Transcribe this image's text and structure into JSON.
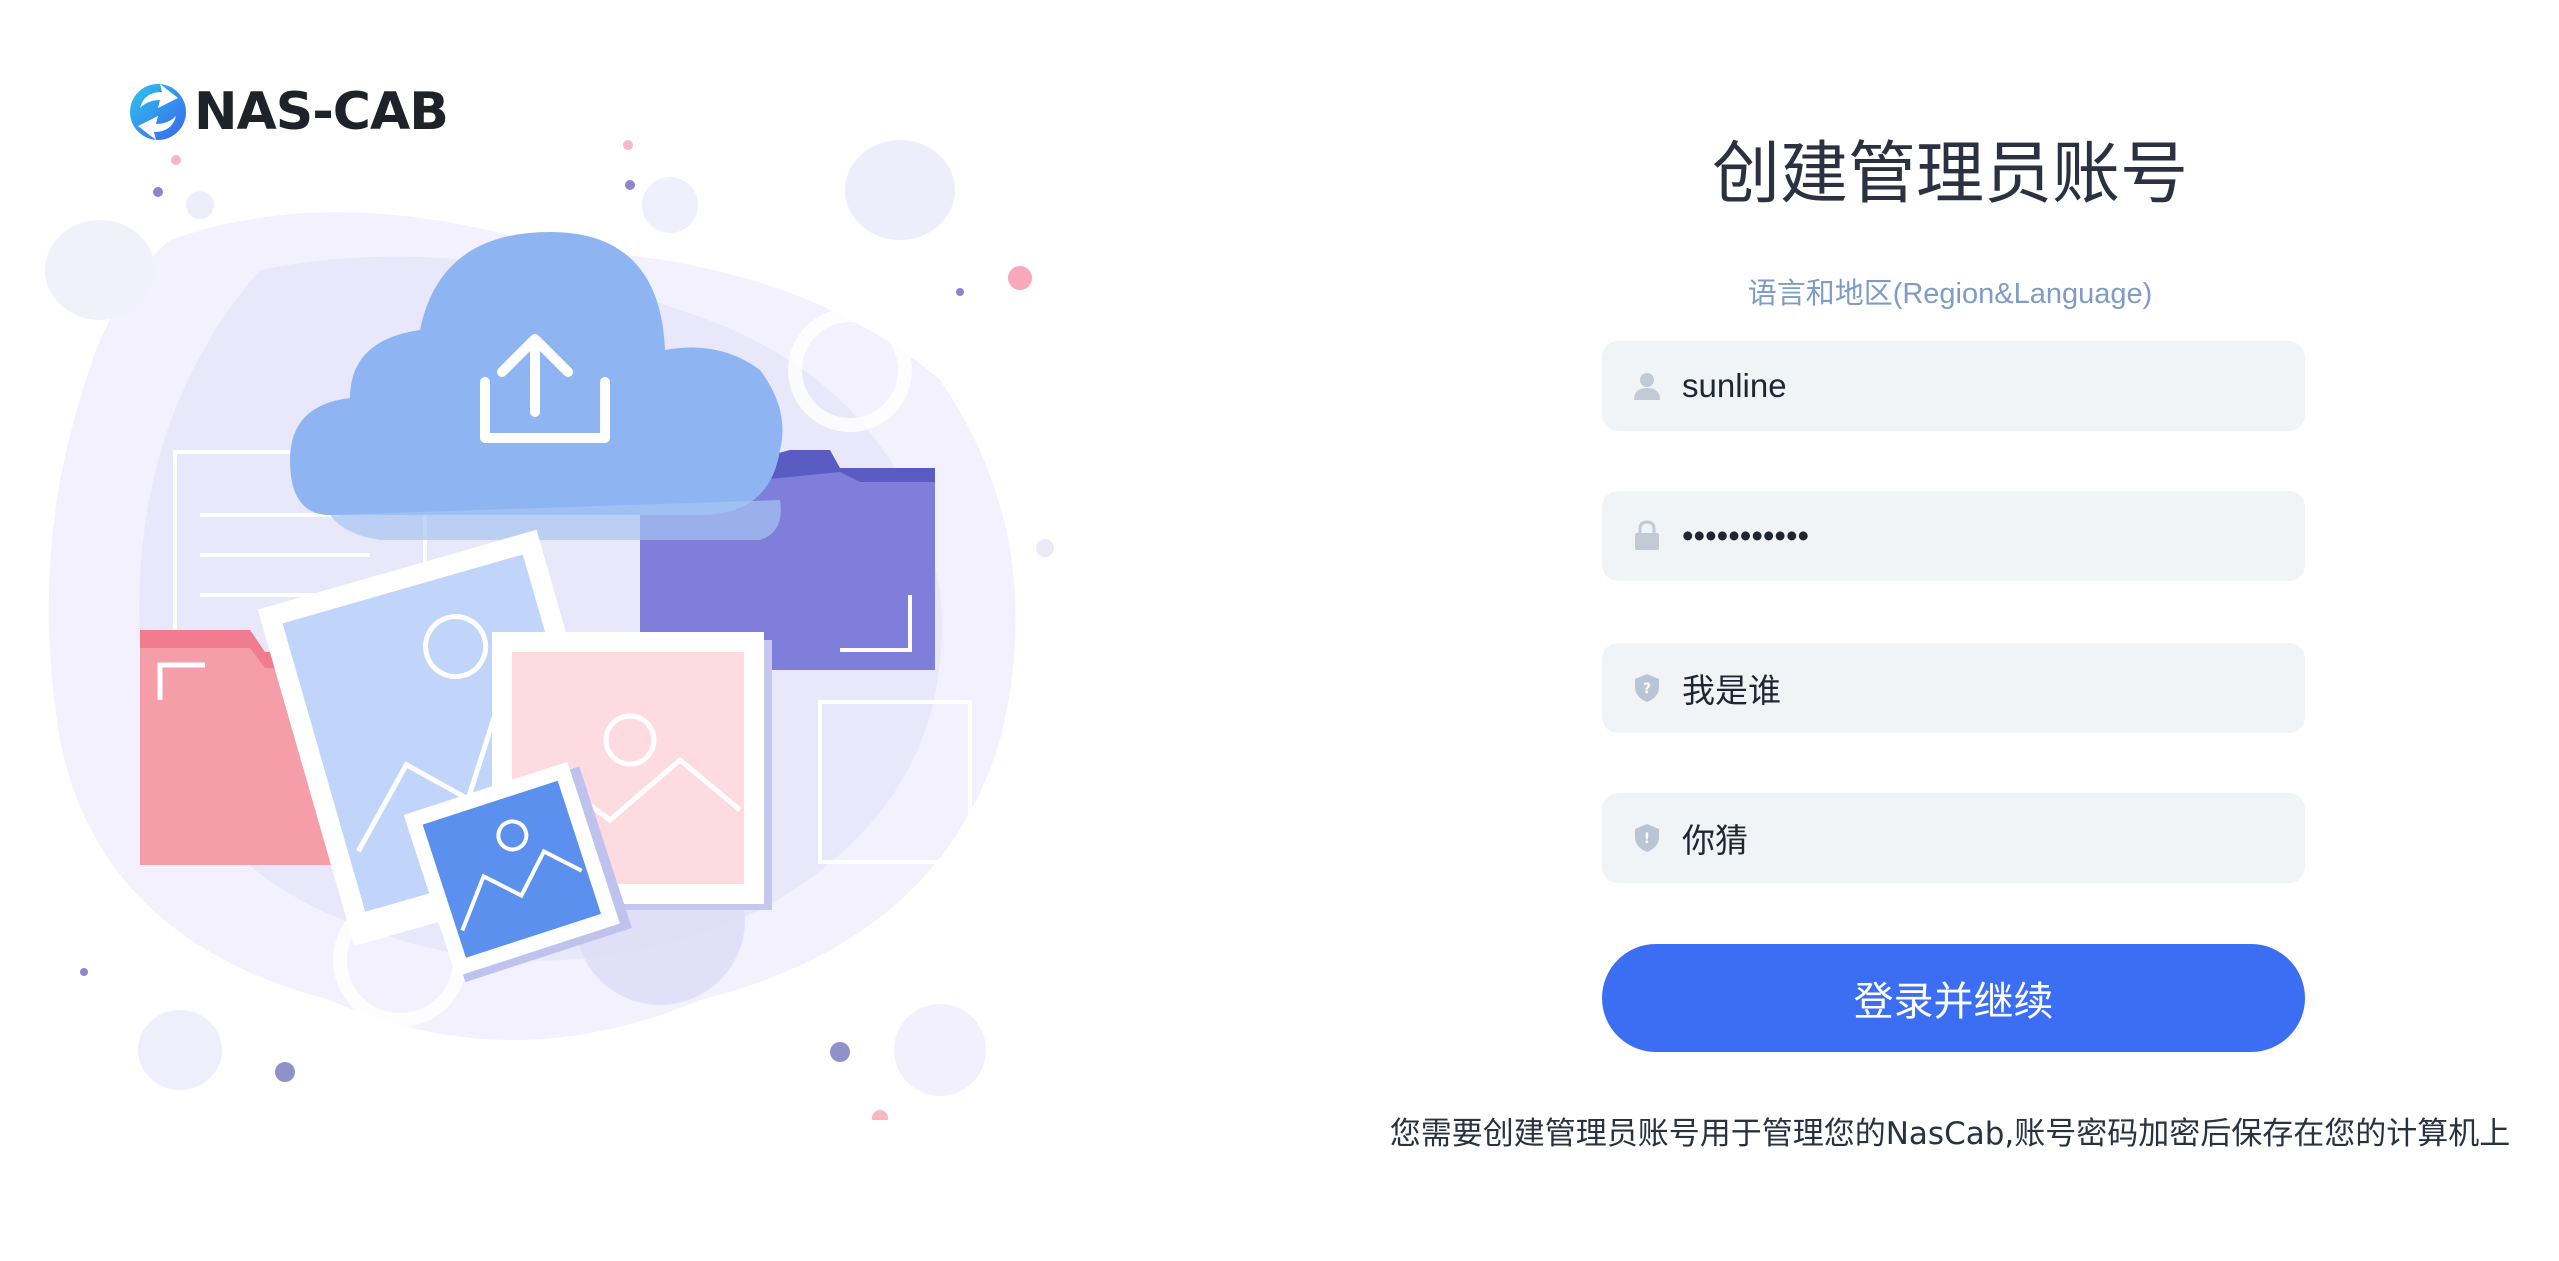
{
  "logo": {
    "text": "NAS-CAB",
    "icon": "sync-arrow-icon"
  },
  "form": {
    "title": "创建管理员账号",
    "language_link": "语言和地区(Region&Language)",
    "username": {
      "value": "sunline",
      "icon": "user-icon"
    },
    "password": {
      "value": "•••••••••••",
      "icon": "lock-icon"
    },
    "question": {
      "value": "我是谁",
      "icon": "shield-question-icon"
    },
    "answer": {
      "value": "你猜",
      "icon": "shield-alert-icon"
    },
    "submit_label": "登录并继续",
    "note": "您需要创建管理员账号用于管理您的NasCab,账号密码加密后保存在您的计算机上"
  },
  "colors": {
    "primary": "#3c6ef3",
    "field_bg": "#f1f4f6",
    "link": "#7e9cc4",
    "title": "#2b3140"
  }
}
